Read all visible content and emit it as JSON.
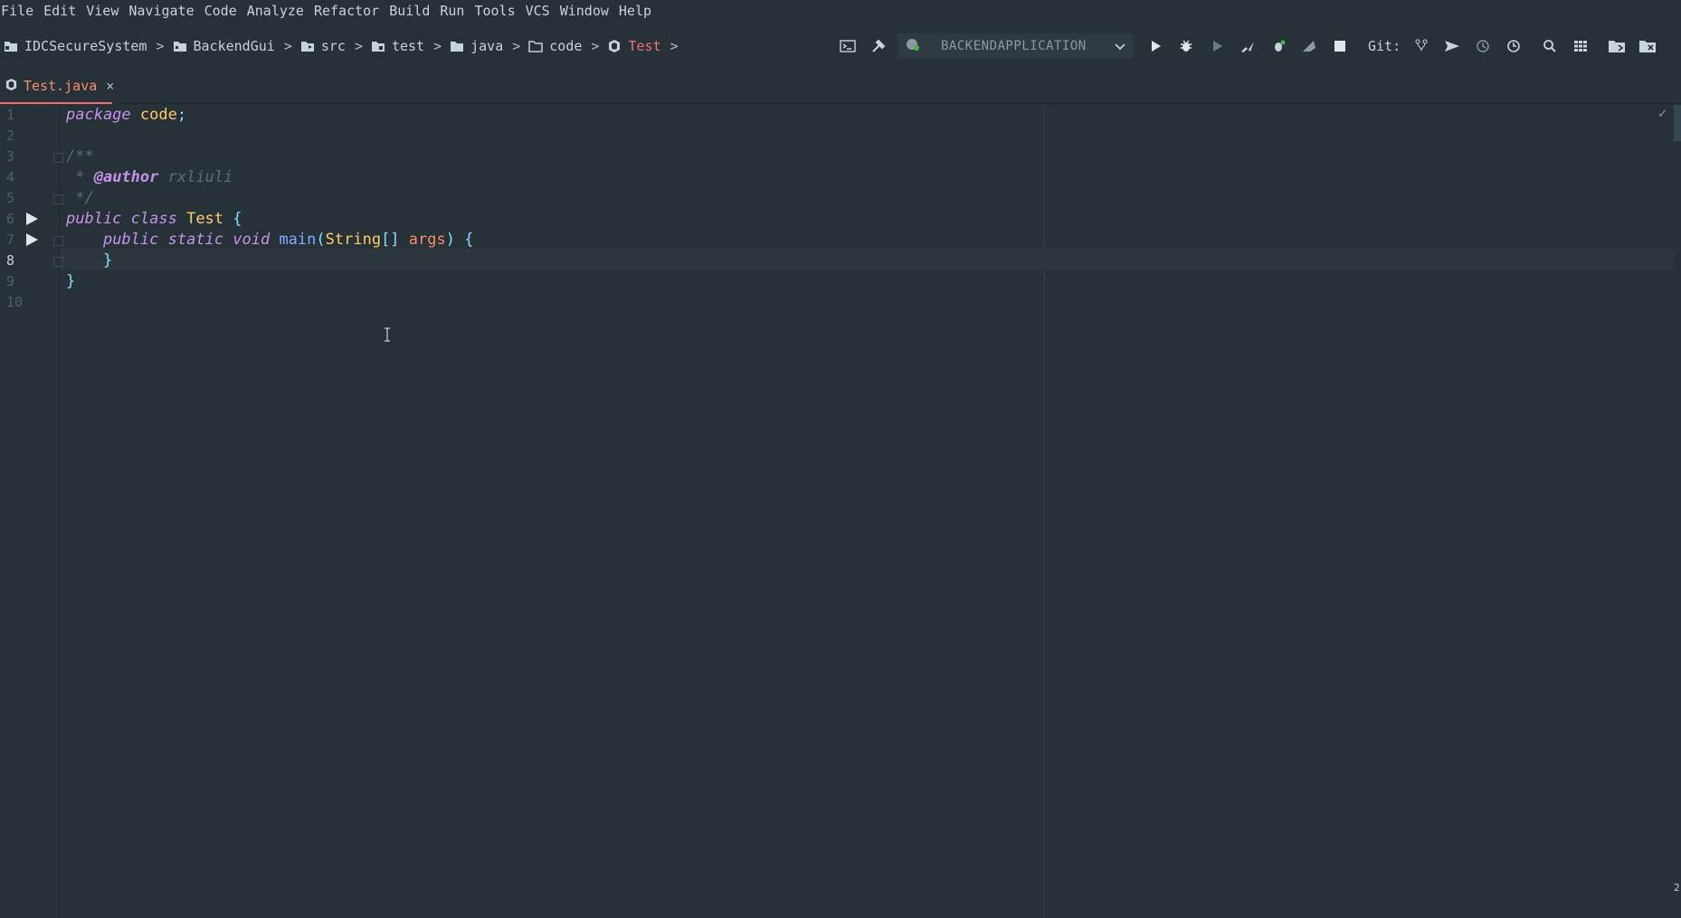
{
  "menu": {
    "items": [
      "File",
      "Edit",
      "View",
      "Navigate",
      "Code",
      "Analyze",
      "Refactor",
      "Build",
      "Run",
      "Tools",
      "VCS",
      "Window",
      "Help"
    ]
  },
  "breadcrumbs": [
    {
      "label": "IDCSecureSystem",
      "icon": "project-folder-icon"
    },
    {
      "label": "BackendGui",
      "icon": "module-folder-icon"
    },
    {
      "label": "src",
      "icon": "source-folder-icon"
    },
    {
      "label": "test",
      "icon": "test-folder-icon"
    },
    {
      "label": "java",
      "icon": "folder-icon"
    },
    {
      "label": "code",
      "icon": "package-icon"
    },
    {
      "label": "Test",
      "icon": "java-class-icon"
    }
  ],
  "toolbar": {
    "run_config": "BACKENDAPPLICATION",
    "git_label": "Git:"
  },
  "tab": {
    "label": "Test.java",
    "close": "×"
  },
  "editor": {
    "line_numbers": [
      "1",
      "2",
      "3",
      "4",
      "5",
      "6",
      "7",
      "8",
      "9",
      "10"
    ],
    "current_line": "8",
    "author": "rxliuli"
  },
  "colors": {
    "background": "#263238",
    "accent": "#f07178",
    "keyword": "#c792ea",
    "class": "#ffcb6b",
    "function": "#82aaff",
    "param": "#f78c6c",
    "comment": "#546e7a"
  },
  "corner_mark": "2"
}
